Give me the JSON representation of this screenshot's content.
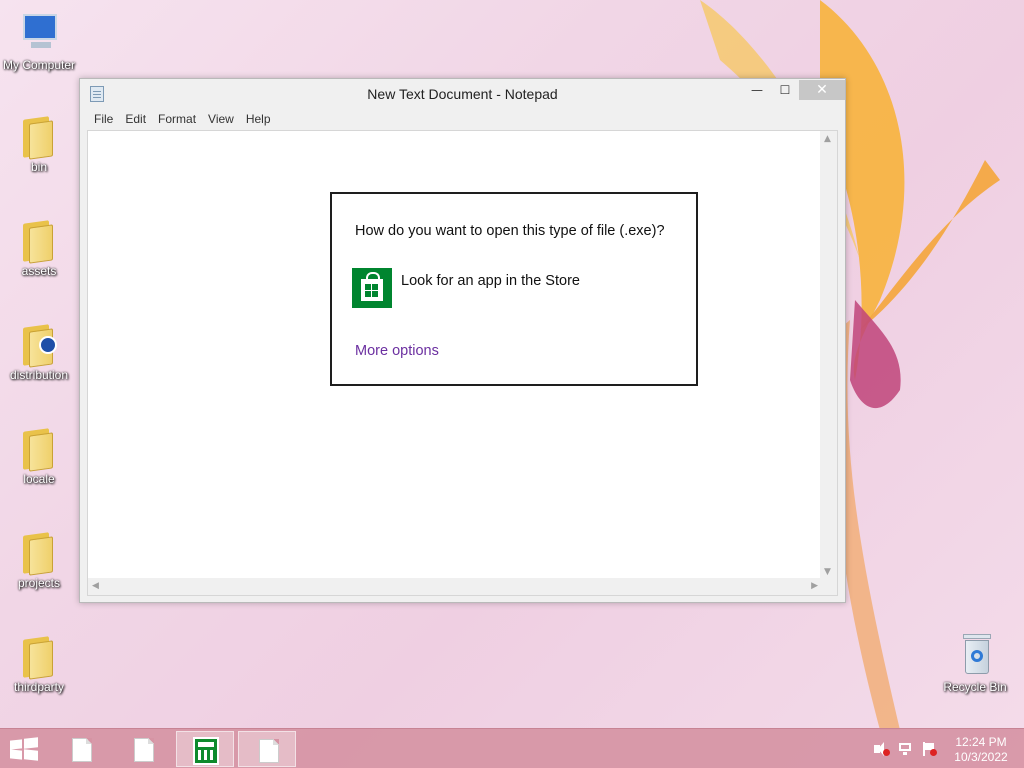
{
  "desktop": {
    "icons": [
      {
        "label": "My Computer",
        "icon": "computer-icon"
      },
      {
        "label": "bin",
        "icon": "folder-icon"
      },
      {
        "label": "assets",
        "icon": "folder-icon"
      },
      {
        "label": "distribution",
        "icon": "folder-icon"
      },
      {
        "label": "locale",
        "icon": "folder-icon"
      },
      {
        "label": "projects",
        "icon": "folder-icon"
      },
      {
        "label": "thirdparty",
        "icon": "folder-icon"
      },
      {
        "label": "Recycle Bin",
        "icon": "recycle-bin-icon"
      }
    ]
  },
  "window": {
    "title": "New Text Document - Notepad",
    "controls": {
      "minimize": "—",
      "maximize": "☐",
      "close": "✕"
    },
    "menu": [
      "File",
      "Edit",
      "Format",
      "View",
      "Help"
    ]
  },
  "dialog": {
    "question": "How do you want to open this type of file (.exe)?",
    "store_option": "Look for an app in the Store",
    "more_options": "More options",
    "store_color": "#00852f",
    "link_color": "#6b2fa0"
  },
  "taskbar": {
    "items": [
      "start-button",
      "text-document",
      "text-document",
      "calculator",
      "notepad"
    ],
    "clock": {
      "time": "12:24 PM",
      "date": "10/3/2022"
    }
  }
}
